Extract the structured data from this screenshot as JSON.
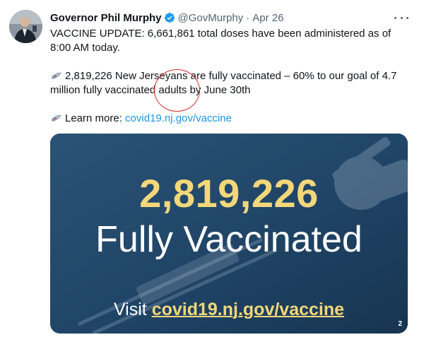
{
  "author": {
    "name": "Governor Phil Murphy",
    "handle": "@GovMurphy",
    "separator": "·",
    "date": "Apr 26",
    "verified": true
  },
  "tweet": {
    "line1": "VACCINE UPDATE: 6,661,861 total doses have been administered as of 8:00 AM today.",
    "line2": "2,819,226 New Jerseyans are fully vaccinated – 60% to our goal of 4.7 million fully vaccinated adults by June 30th",
    "line3_prefix": "Learn more: ",
    "line3_link": "covid19.nj.gov/vaccine"
  },
  "media": {
    "number": "2,819,226",
    "label": "Fully Vaccinated",
    "visit_prefix": "Visit ",
    "visit_url": "covid19.nj.gov/vaccine",
    "page_badge": "2"
  },
  "icons": {
    "verified": "verified-badge-icon",
    "more": "more-icon",
    "syringe": "syringe-icon"
  },
  "colors": {
    "link": "#1b95e0",
    "verified": "#1d9bf0",
    "media_bg": "#1f4466",
    "highlight": "#f3d77a",
    "annotation": "#d42a2a"
  }
}
